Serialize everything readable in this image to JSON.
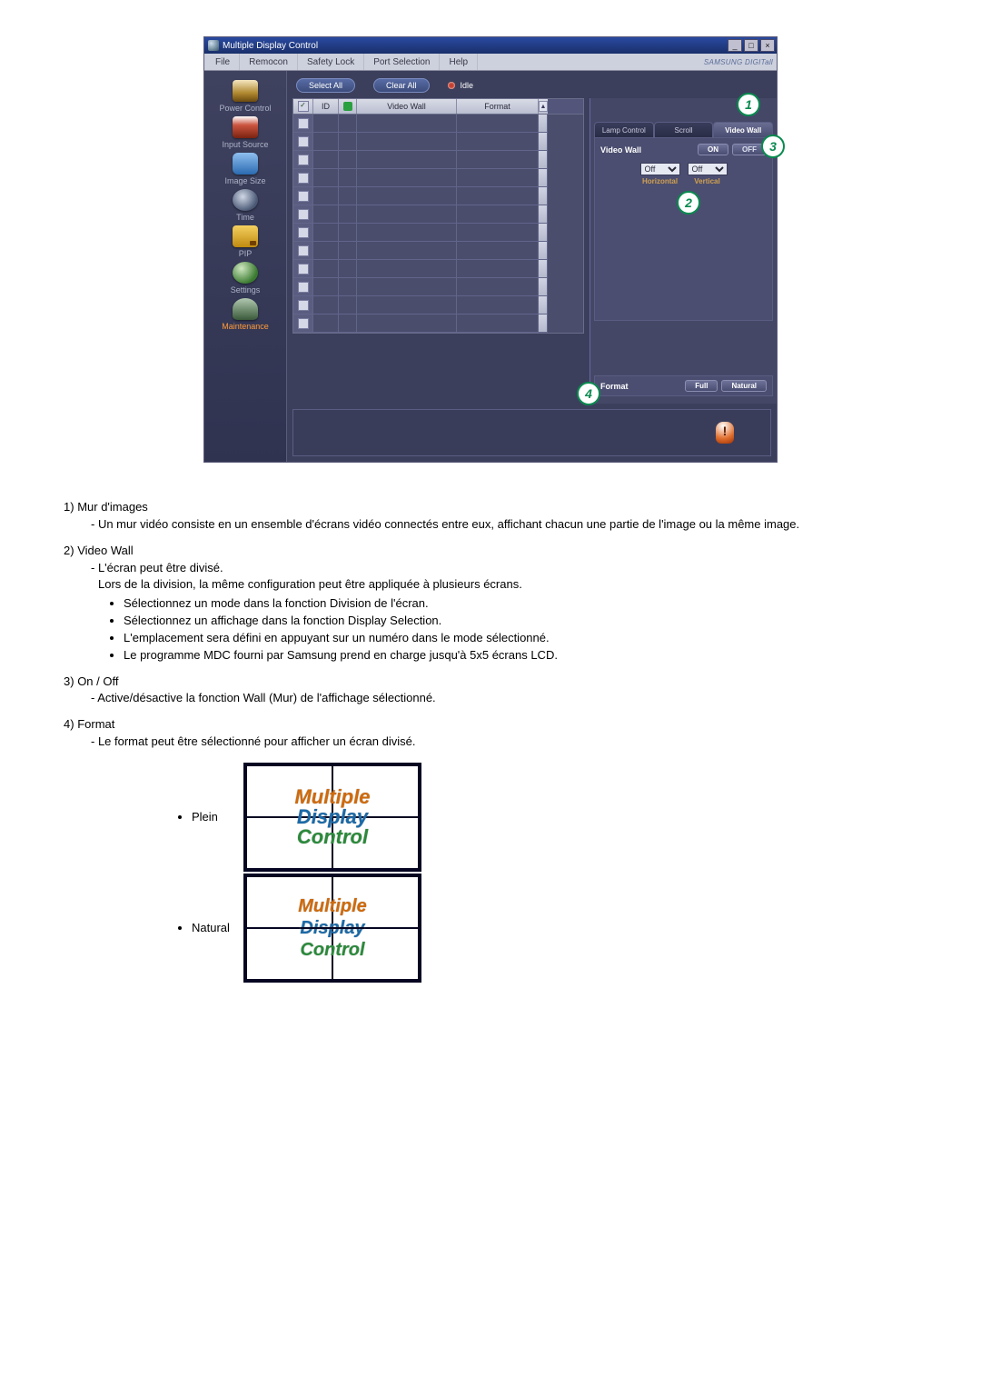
{
  "window": {
    "title": "Multiple Display Control",
    "menus": [
      "File",
      "Remocon",
      "Safety Lock",
      "Port Selection",
      "Help"
    ],
    "brand": "SAMSUNG DIGITall"
  },
  "sidebar": {
    "items": [
      {
        "label": "Power Control"
      },
      {
        "label": "Input Source"
      },
      {
        "label": "Image Size"
      },
      {
        "label": "Time"
      },
      {
        "label": "PIP"
      },
      {
        "label": "Settings"
      },
      {
        "label": "Maintenance",
        "active": true
      }
    ]
  },
  "toolbar": {
    "select_all": "Select All",
    "clear_all": "Clear All",
    "status": "Idle"
  },
  "grid": {
    "headers": {
      "id": "ID",
      "vw": "Video Wall",
      "fmt": "Format"
    }
  },
  "right": {
    "tabs": [
      "Lamp Control",
      "Scroll",
      "Video Wall"
    ],
    "active_tab": 2,
    "video_wall_label": "Video Wall",
    "on": "ON",
    "off": "OFF",
    "horizontal": {
      "value": "Off",
      "label": "Horizontal"
    },
    "vertical": {
      "value": "Off",
      "label": "Vertical"
    },
    "format_label": "Format",
    "full": "Full",
    "natural": "Natural"
  },
  "callouts": {
    "c1": "1",
    "c2": "2",
    "c3": "3",
    "c4": "4"
  },
  "doc": {
    "s1": {
      "num": "1)",
      "title": "Mur d'images",
      "dash": "- Un mur vidéo consiste en un ensemble d'écrans vidéo connectés entre eux, affichant chacun une partie de l'image ou la même image."
    },
    "s2": {
      "num": "2)",
      "title": "Video Wall",
      "dash": "- L'écran peut être divisé.",
      "line2": "Lors de la division, la même configuration peut être appliquée à plusieurs écrans.",
      "b1": "Sélectionnez un mode dans la fonction Division de l'écran.",
      "b2": "Sélectionnez un affichage dans la fonction Display Selection.",
      "b3": "L'emplacement sera défini en appuyant sur un numéro dans le mode sélectionné.",
      "b4": "Le programme MDC fourni par Samsung prend en charge jusqu'à 5x5 écrans LCD."
    },
    "s3": {
      "num": "3)",
      "title": "On / Off",
      "dash": "- Active/désactive la fonction Wall (Mur) de l'affichage sélectionné."
    },
    "s4": {
      "num": "4)",
      "title": "Format",
      "dash": "- Le format peut être sélectionné pour afficher un écran divisé."
    },
    "fmt_plein": "Plein",
    "fmt_natural": "Natural",
    "mdc_lines": [
      "Multiple",
      "Display",
      "Control"
    ]
  }
}
